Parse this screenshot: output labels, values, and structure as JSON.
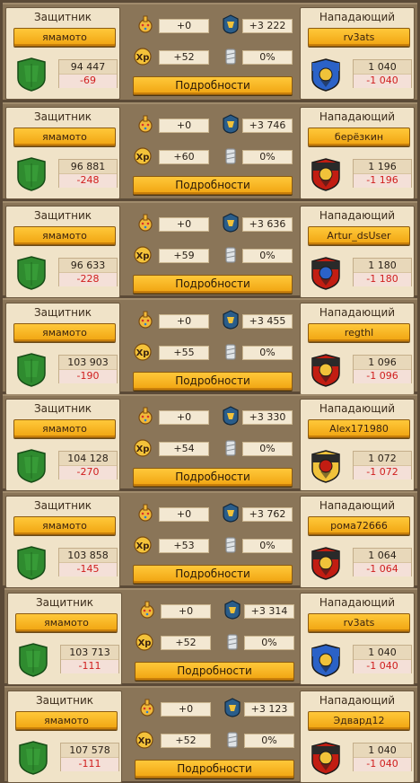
{
  "labels": {
    "defender": "Защитник",
    "attacker": "Нападающий",
    "details": "Подробности"
  },
  "icons": {
    "bonus": "crown-orb-icon",
    "power": "shield-badge-icon",
    "xp": "xp-icon",
    "loss": "broken-statue-icon",
    "defender_shield": "green-shield-icon",
    "attacker_shield": "emblem-shield-icon"
  },
  "colors": {
    "gold_button": "#f5b21c",
    "loss_red": "#d01e1e",
    "defender_shield": "#2f8b2f",
    "attacker_blue": "#2b62c7",
    "attacker_red": "#c21d12"
  },
  "battles": [
    {
      "defender": {
        "name": "ямамото",
        "power": "94 447",
        "loss": "-69"
      },
      "bonus": "+0",
      "power_gain": "+3 222",
      "xp": "+52",
      "percent": "0%",
      "attacker": {
        "name": "rv3ats",
        "power": "1 040",
        "loss": "-1 040",
        "emblem": "blue"
      }
    },
    {
      "defender": {
        "name": "ямамото",
        "power": "96 881",
        "loss": "-248"
      },
      "bonus": "+0",
      "power_gain": "+3 746",
      "xp": "+60",
      "percent": "0%",
      "attacker": {
        "name": "берёзкин",
        "power": "1 196",
        "loss": "-1 196",
        "emblem": "red"
      }
    },
    {
      "defender": {
        "name": "ямамото",
        "power": "96 633",
        "loss": "-228"
      },
      "bonus": "+0",
      "power_gain": "+3 636",
      "xp": "+59",
      "percent": "0%",
      "attacker": {
        "name": "Artur_dsUser",
        "power": "1 180",
        "loss": "-1 180",
        "emblem": "redblue"
      }
    },
    {
      "defender": {
        "name": "ямамото",
        "power": "103 903",
        "loss": "-190"
      },
      "bonus": "+0",
      "power_gain": "+3 455",
      "xp": "+55",
      "percent": "0%",
      "attacker": {
        "name": "regthl",
        "power": "1 096",
        "loss": "-1 096",
        "emblem": "red"
      }
    },
    {
      "defender": {
        "name": "ямамото",
        "power": "104 128",
        "loss": "-270"
      },
      "bonus": "+0",
      "power_gain": "+3 330",
      "xp": "+54",
      "percent": "0%",
      "attacker": {
        "name": "Alex171980",
        "power": "1 072",
        "loss": "-1 072",
        "emblem": "redyellow"
      }
    },
    {
      "defender": {
        "name": "ямамото",
        "power": "103 858",
        "loss": "-145"
      },
      "bonus": "+0",
      "power_gain": "+3 762",
      "xp": "+53",
      "percent": "0%",
      "attacker": {
        "name": "рома72666",
        "power": "1 064",
        "loss": "-1 064",
        "emblem": "red"
      }
    },
    {
      "defender": {
        "name": "ямамото",
        "power": "103 713",
        "loss": "-111"
      },
      "bonus": "+0",
      "power_gain": "+3 314",
      "xp": "+52",
      "percent": "0%",
      "attacker": {
        "name": "rv3ats",
        "power": "1 040",
        "loss": "-1 040",
        "emblem": "blue"
      }
    },
    {
      "defender": {
        "name": "ямамото",
        "power": "107 578",
        "loss": "-111"
      },
      "bonus": "+0",
      "power_gain": "+3 123",
      "xp": "+52",
      "percent": "0%",
      "attacker": {
        "name": "Эдвард12",
        "power": "1 040",
        "loss": "-1 040",
        "emblem": "red"
      }
    }
  ]
}
